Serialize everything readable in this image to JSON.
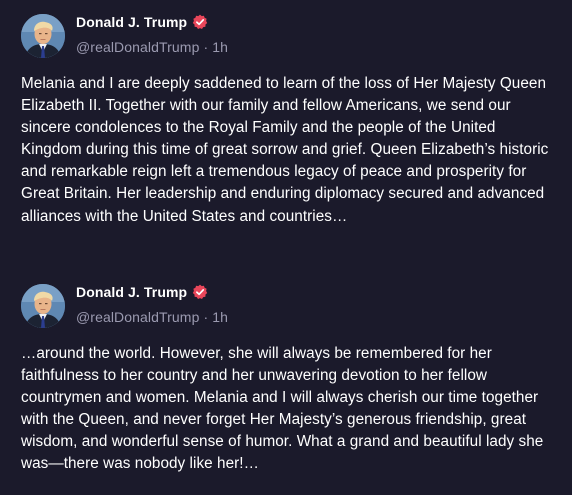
{
  "colors": {
    "background": "#1b1a2b",
    "text": "#ffffff",
    "muted": "#9b9ab0",
    "verified_badge": "#e8465a"
  },
  "posts": [
    {
      "author": {
        "display_name": "Donald J. Trump",
        "handle": "@realDonaldTrump",
        "separator": "·",
        "time": "1h",
        "avatar_icon": "avatar-portrait",
        "verified_icon": "verified-badge-icon"
      },
      "text": "Melania and I are deeply saddened to learn of the loss of Her Majesty Queen Elizabeth II. Together with our family and fellow Americans, we send our sincere condolences to the Royal Family and the people of the United Kingdom during this time of great sorrow and grief. Queen Elizabeth’s historic and remarkable reign left a tremendous legacy of peace and prosperity for Great Britain. Her leadership and enduring diplomacy secured and advanced alliances with the United States and countries…"
    },
    {
      "author": {
        "display_name": "Donald J. Trump",
        "handle": "@realDonaldTrump",
        "separator": "·",
        "time": "1h",
        "avatar_icon": "avatar-portrait",
        "verified_icon": "verified-badge-icon"
      },
      "text": "…around the world. However, she will always be remembered for her faithfulness to her country and her unwavering devotion to her fellow countrymen and women. Melania and I will always cherish our time together with the Queen, and never forget Her Majesty’s generous friendship, great wisdom, and wonderful sense of humor. What a grand and beautiful lady she was—there was nobody like her!…"
    }
  ]
}
